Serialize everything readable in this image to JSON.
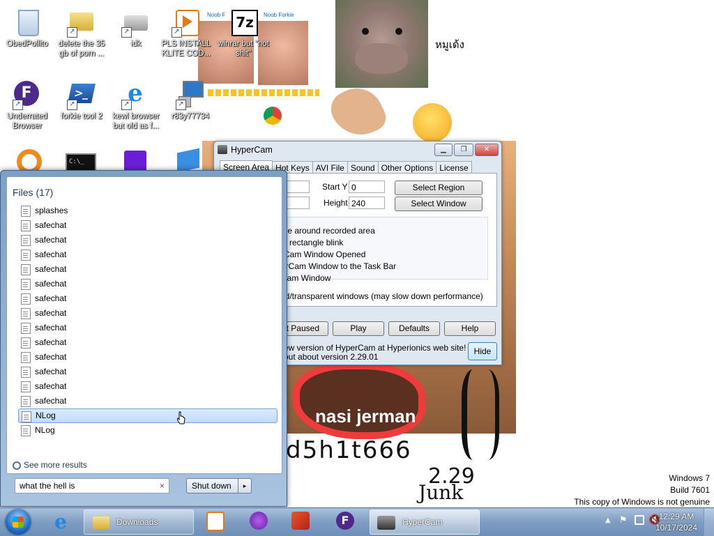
{
  "desktop": {
    "icons": [
      {
        "label": "ObedPollito",
        "icon": "recycle-bin-icon"
      },
      {
        "label": "delete the 35 gb of porn ...",
        "icon": "folder-shortcut-icon"
      },
      {
        "label": "idk",
        "icon": "fax-printer-icon"
      },
      {
        "label": "PLS INSTALL KLITE COD...",
        "icon": "media-player-icon"
      },
      {
        "label": "winrar but \"not shit\"",
        "icon": "7zip-icon"
      },
      {
        "label": "Underrated Browser",
        "icon": "browser-f-icon"
      },
      {
        "label": "forkie tool 2",
        "icon": "powershell-icon"
      },
      {
        "label": "kewl browser but old as f...",
        "icon": "internet-explorer-icon"
      },
      {
        "label": "r83y77734",
        "icon": "network-computer-icon"
      }
    ],
    "thai_text": "หมูเด้ง",
    "painted_text": "nasi jerman",
    "scribble_text": "d5h1t666",
    "scribble_text_2": "2.29",
    "scribble_text_3": "Junk",
    "noob_label_1": "Noob F",
    "noob_label_2": "Noob Forkie",
    "watermark": {
      "line1": "Windows 7",
      "line2": "Build 7601",
      "line3": "This copy of Windows is not genuine"
    }
  },
  "hypercam": {
    "title": "HyperCam",
    "tabs": [
      "Screen Area",
      "Hot Keys",
      "AVI File",
      "Sound",
      "Other Options",
      "License"
    ],
    "fields": {
      "start_y_label": "Start Y",
      "start_y_value": "0",
      "height_label": "Height",
      "height_value": "240"
    },
    "buttons": {
      "select_region": "Select Region",
      "select_window": "Select Window",
      "start_paused": "art Paused",
      "play": "Play",
      "defaults": "Defaults",
      "help": "Help",
      "hide": "Hide"
    },
    "options": [
      "gle around recorded area",
      "is rectangle blink",
      "rCam Window Opened",
      "erCam Window to the Task Bar",
      "Cam Window"
    ],
    "layered_note": "ed/transparent windows (may slow down performance)",
    "footer_line1": "ew version of HyperCam at Hyperionics web site! Click",
    "footer_line2": "out about version 2.29.01"
  },
  "start_menu": {
    "header": "Files (17)",
    "items": [
      {
        "label": "splashes",
        "selected": false
      },
      {
        "label": "safechat",
        "selected": false
      },
      {
        "label": "safechat",
        "selected": false
      },
      {
        "label": "safechat",
        "selected": false
      },
      {
        "label": "safechat",
        "selected": false
      },
      {
        "label": "safechat",
        "selected": false
      },
      {
        "label": "safechat",
        "selected": false
      },
      {
        "label": "safechat",
        "selected": false
      },
      {
        "label": "safechat",
        "selected": false
      },
      {
        "label": "safechat",
        "selected": false
      },
      {
        "label": "safechat",
        "selected": false
      },
      {
        "label": "safechat",
        "selected": false
      },
      {
        "label": "safechat",
        "selected": false
      },
      {
        "label": "safechat",
        "selected": false
      },
      {
        "label": "NLog",
        "selected": true
      },
      {
        "label": "NLog",
        "selected": false
      }
    ],
    "see_more": "See more results",
    "search_value": "what the hell is",
    "clear_glyph": "×",
    "shutdown_label": "Shut down",
    "shutdown_arrow": "▸"
  },
  "taskbar": {
    "downloads_label": "Downloads",
    "hypercam_label": "HyperCam",
    "time": "12:29 AM",
    "date": "10/17/2024"
  },
  "colors": {
    "taskbar": "#7f9dc2",
    "start_menu_accent": "#1e395b",
    "selected_item": "#c1dbfc"
  }
}
